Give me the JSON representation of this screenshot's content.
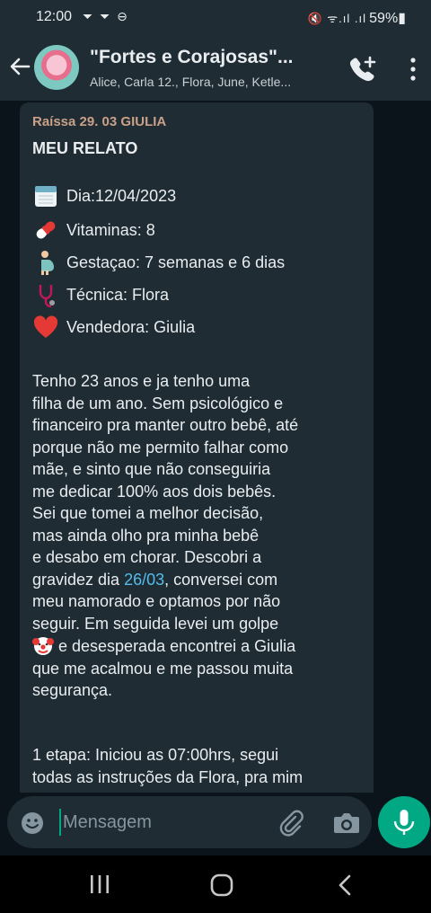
{
  "status_bar": {
    "time": "12:00",
    "left_icons": "⏷ ⏷ ⊖",
    "right_icons": "🔇 ᯤ.ıl .ıl",
    "battery": "59%"
  },
  "header": {
    "title": "\"Fortes e Corajosas\"...",
    "subtitle": "Alice, Carla 12., Flora, June, Ketle..."
  },
  "message": {
    "sender": "Raíssa 29. 03 GIULIA",
    "title": "MEU RELATO",
    "info": [
      {
        "icon": "calendar-icon",
        "text": "Dia:12/04/2023"
      },
      {
        "icon": "pill-icon",
        "text": "Vitaminas: 8"
      },
      {
        "icon": "pregnant-woman-icon",
        "text": "Gestaçao: 7 semanas e 6 dias"
      },
      {
        "icon": "stethoscope-icon",
        "text": "Técnica: Flora"
      },
      {
        "icon": "heart-icon",
        "text": "Vendedora: Giulia"
      }
    ],
    "para1_a": "Tenho 23 anos e ja tenho uma\nfilha de um ano. Sem psicológico e\nfinanceiro pra manter outro bebê, até\nporque não me permito falhar como\nmãe, e sinto que não conseguiria\nme dedicar 100% aos dois bebês.\nSei que tomei a melhor decisão,\nmas ainda olho pra minha bebê\ne desabo em chorar. Descobri a\ngravidez dia ",
    "para1_link": "26/03",
    "para1_b": ", conversei com\nmeu namorado e optamos por não\nseguir. Em seguida levei um golpe\n",
    "para1_emoji": "clown-face-icon",
    "para1_c": " e desesperada encontrei a Giulia\nque me acalmou e me passou muita\nsegurança.",
    "para2": "1 etapa: Iniciou as 07:00hrs, segui\ntodas as instruções da Flora, pra mim"
  },
  "input": {
    "placeholder": "Mensagem",
    "value": ""
  },
  "colors": {
    "header_bg": "#1f2c34",
    "chat_bg": "#0b141a",
    "bubble_bg": "#1f2c34",
    "accent": "#00a884",
    "link": "#53bdeb",
    "sender": "#c9a188"
  }
}
